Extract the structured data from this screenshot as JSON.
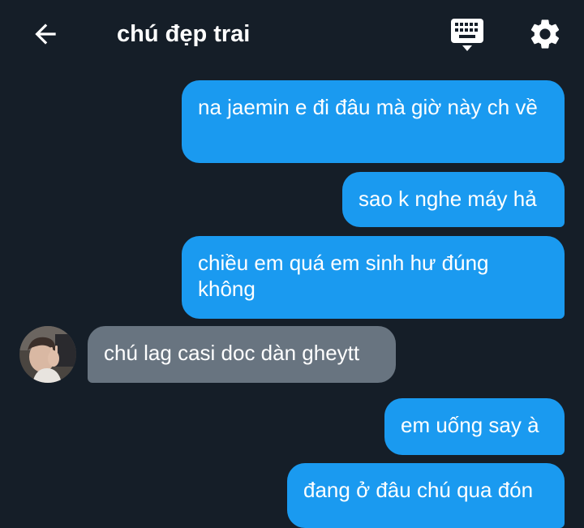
{
  "header": {
    "title": "chú đẹp trai",
    "back_icon": "arrow-left-icon",
    "keyboard_icon": "keyboard-icon",
    "settings_icon": "gear-icon"
  },
  "colors": {
    "background": "#151e28",
    "sent_bubble": "#1a9af0",
    "received_bubble": "#687480",
    "text": "#ffffff"
  },
  "messages": [
    {
      "direction": "sent",
      "text": "na jaemin e đi đâu mà giờ này ch về"
    },
    {
      "direction": "sent",
      "text": "sao k nghe máy hả"
    },
    {
      "direction": "sent",
      "text": "chiều em quá em sinh hư đúng không"
    },
    {
      "direction": "received",
      "text": "chú lag casi doc dàn gheytt"
    },
    {
      "direction": "sent",
      "text": "em uống say à"
    },
    {
      "direction": "sent",
      "text": "đang ở đâu chú qua đón"
    }
  ]
}
